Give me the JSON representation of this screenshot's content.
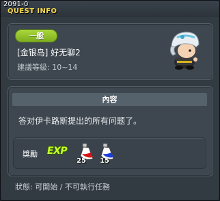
{
  "window": {
    "quest_id": "2091-0",
    "title": "QUEST INFO"
  },
  "quest": {
    "difficulty_badge": "一般",
    "name": "[金银岛] 好无聊2",
    "recommended_level": "建議等級: 10~14",
    "npc_icon": "npc-avatar-helmet"
  },
  "content": {
    "header": "內容",
    "text": "答对伊卡路斯提出的所有问题了。"
  },
  "reward": {
    "label": "獎勵",
    "exp_label": "EXP",
    "items": [
      {
        "icon": "red-potion-icon",
        "count": "25",
        "color": "#d01818"
      },
      {
        "icon": "blue-potion-icon",
        "count": "15",
        "color": "#1c3fd8"
      }
    ]
  },
  "status": {
    "text": "狀態: 可開始 / 不可執行任務"
  },
  "colors": {
    "title_accent": "#f6d84a",
    "badge_green": "#8fc22a",
    "exp_green": "#c8ff2a"
  }
}
